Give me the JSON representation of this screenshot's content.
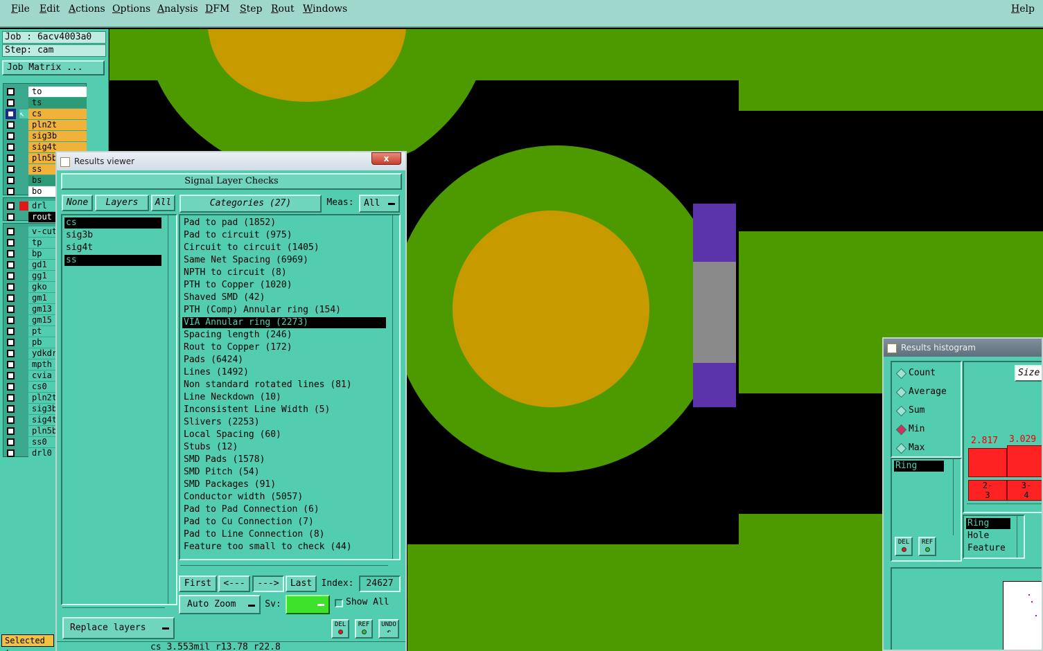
{
  "menu": {
    "items": [
      "File",
      "Edit",
      "Actions",
      "Options",
      "Analysis",
      "DFM",
      "Step",
      "Rout",
      "Windows"
    ],
    "help": "Help"
  },
  "left_panel": {
    "job": "Job : 6acv4003a0",
    "step": "Step: cam",
    "job_matrix": "Job Matrix ...",
    "layers_group1": [
      {
        "name": "to",
        "style": "white"
      },
      {
        "name": "ts",
        "style": "green"
      },
      {
        "name": "cs",
        "style": "orange"
      },
      {
        "name": "pln2t",
        "style": "orange"
      },
      {
        "name": "sig3b",
        "style": "orange"
      },
      {
        "name": "sig4t",
        "style": "orange"
      },
      {
        "name": "pln5b",
        "style": "orange"
      },
      {
        "name": "ss",
        "style": "orange"
      },
      {
        "name": "bs",
        "style": "green"
      },
      {
        "name": "bo",
        "style": "white"
      }
    ],
    "layers_group2": [
      {
        "name": "drl",
        "style": "teal"
      },
      {
        "name": "rout",
        "style": "black"
      }
    ],
    "layers_group3": [
      "v-cut",
      "tp",
      "bp",
      "gd1",
      "gg1",
      "gko",
      "gm1",
      "gm13",
      "gm15",
      "pt",
      "pb",
      "ydkdr",
      "mpth",
      "cvia",
      "cs0",
      "pln2t",
      "sig3b",
      "sig4t",
      "pln5b",
      "ss0",
      "drl0"
    ],
    "selected": "Selected :"
  },
  "results_viewer": {
    "title": "Results viewer",
    "close": "x",
    "header": "Signal Layer Checks",
    "none_btn": "None",
    "layers_btn": "Layers",
    "all_btn": "All",
    "categories_btn": "Categories (27)",
    "meas_label": "Meas:",
    "meas_value": "All",
    "layers": [
      {
        "name": "cs",
        "selected": true
      },
      {
        "name": "sig3b",
        "selected": false
      },
      {
        "name": "sig4t",
        "selected": false
      },
      {
        "name": "ss",
        "selected": true
      }
    ],
    "categories": [
      "Pad to pad (1852)",
      "Pad to circuit (975)",
      "Circuit to circuit (1405)",
      "Same Net Spacing (6969)",
      "NPTH to circuit (8)",
      "PTH to Copper (1020)",
      "Shaved SMD (42)",
      "PTH (Comp) Annular ring (154)",
      "VIA Annular ring (2273)",
      "Spacing length (246)",
      "Rout to Copper (172)",
      "Pads (6424)",
      "Lines (1492)",
      "Non standard rotated lines (81)",
      "Line Neckdown (10)",
      "Inconsistent Line Width (5)",
      "Slivers (2253)",
      "Local Spacing (60)",
      "Stubs (12)",
      "SMD Pads (1578)",
      "SMD Pitch (54)",
      "SMD Packages (91)",
      "Conductor width (5057)",
      "Pad to Pad Connection (6)",
      "Pad to Cu Connection (7)",
      "Pad to Line Connection (8)",
      "Feature too small to check (44)"
    ],
    "selected_category": "VIA Annular ring (2273)",
    "first_btn": "First",
    "prev_btn": "<---",
    "next_btn": "--->",
    "last_btn": "Last",
    "index_label": "Index:",
    "index_value": "24627",
    "auto_zoom": "Auto Zoom",
    "sv_label": "Sv:",
    "show_all": "Show All",
    "replace_layers": "Replace layers",
    "del": "DEL",
    "ref": "REF",
    "undo": "UNDO",
    "status": "cs 3.553mil  r13.78  r22.8"
  },
  "histogram": {
    "title": "Results histogram",
    "modes": [
      "Count",
      "Average",
      "Sum",
      "Min",
      "Max"
    ],
    "selected_mode": "Min",
    "size_btn": "Size",
    "list1": [
      "Ring"
    ],
    "list2": [
      "Ring",
      "Hole",
      "Feature"
    ],
    "bars": [
      {
        "value": "2.817",
        "range_top": "2-",
        "range_bottom": "3"
      },
      {
        "value": "3.029",
        "range_top": "3-",
        "range_bottom": "4"
      }
    ],
    "del": "DEL",
    "ref": "REF"
  },
  "colors": {
    "panel": "#52cdb0",
    "pcb_green": "#4c9a00",
    "pad_gold": "#c79a00",
    "highlight_purple": "#5a34a8",
    "highlight_gray": "#8a8a8a"
  }
}
